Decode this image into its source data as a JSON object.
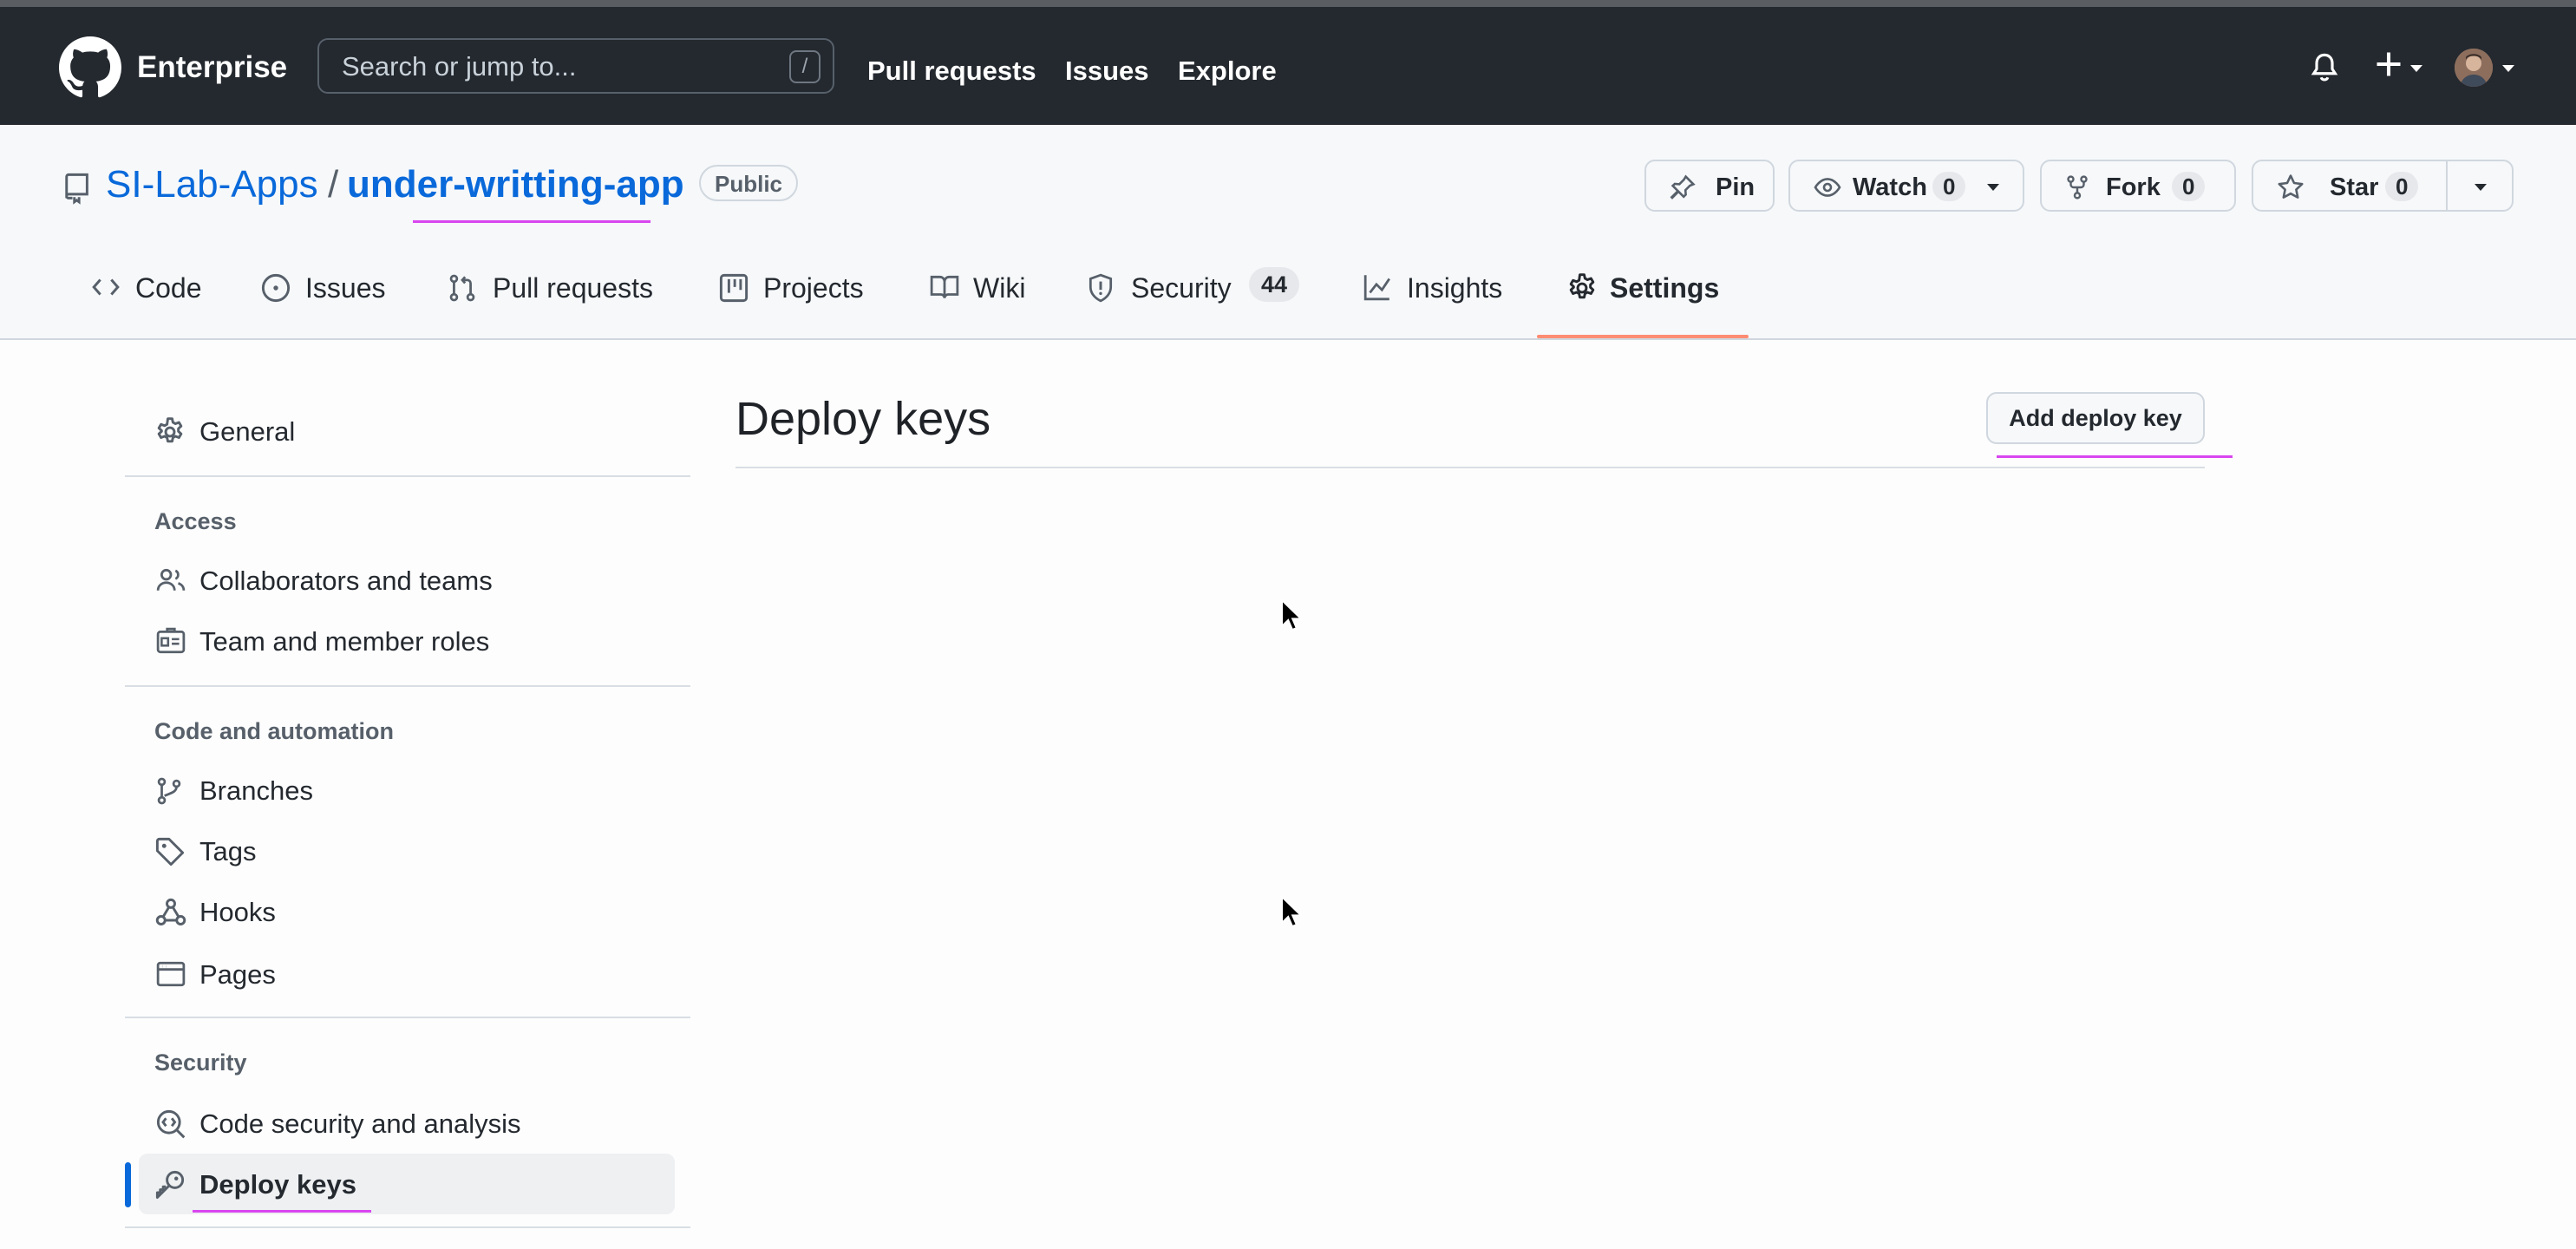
{
  "header": {
    "brand": "Enterprise",
    "search_placeholder": "Search or jump to...",
    "search_shortcut": "/",
    "nav": [
      "Pull requests",
      "Issues",
      "Explore"
    ],
    "icons": [
      "github-logo-icon",
      "bell-icon",
      "plus-icon",
      "avatar"
    ]
  },
  "repo": {
    "owner": "SI-Lab-Apps",
    "separator": "/",
    "name": "under-writting-app",
    "visibility": "Public",
    "actions": {
      "pin": "Pin",
      "watch": "Watch",
      "watch_count": "0",
      "fork": "Fork",
      "fork_count": "0",
      "star": "Star",
      "star_count": "0"
    },
    "tabs": [
      {
        "label": "Code",
        "icon": "code-icon"
      },
      {
        "label": "Issues",
        "icon": "issue-opened-icon"
      },
      {
        "label": "Pull requests",
        "icon": "git-pull-request-icon"
      },
      {
        "label": "Projects",
        "icon": "table-icon"
      },
      {
        "label": "Wiki",
        "icon": "book-icon"
      },
      {
        "label": "Security",
        "icon": "shield-icon",
        "count": "44"
      },
      {
        "label": "Insights",
        "icon": "graph-icon"
      },
      {
        "label": "Settings",
        "icon": "gear-icon",
        "selected": true
      }
    ]
  },
  "sidebar": {
    "general": "General",
    "sections": [
      {
        "heading": "Access",
        "items": [
          "Collaborators and teams",
          "Team and member roles"
        ]
      },
      {
        "heading": "Code and automation",
        "items": [
          "Branches",
          "Tags",
          "Hooks",
          "Pages"
        ]
      },
      {
        "heading": "Security",
        "items": [
          "Code security and analysis",
          "Deploy keys"
        ]
      }
    ],
    "active": "Deploy keys"
  },
  "main": {
    "title": "Deploy keys",
    "add_button": "Add deploy key"
  },
  "colors": {
    "header_bg": "#24292f",
    "link": "#0969da",
    "tab_underline": "#fd8c73",
    "annotation": "#d946ef"
  }
}
